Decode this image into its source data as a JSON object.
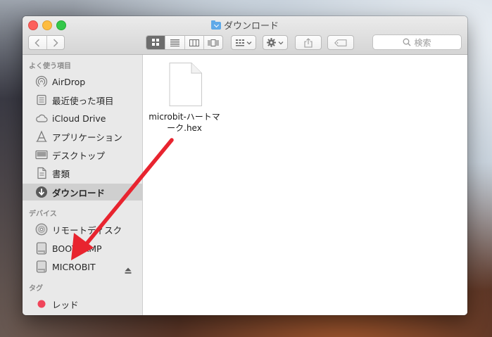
{
  "window": {
    "title": "ダウンロード"
  },
  "toolbar": {
    "back_icon": "chevron-left-icon",
    "forward_icon": "chevron-right-icon",
    "views": [
      "icon-view",
      "list-view",
      "column-view",
      "cover-flow-view"
    ],
    "active_view": "icon-view",
    "search_placeholder": "検索"
  },
  "sidebar": {
    "favorites_header": "よく使う項目",
    "favorites": [
      {
        "label": "AirDrop",
        "icon": "airdrop-icon"
      },
      {
        "label": "最近使った項目",
        "icon": "recents-icon"
      },
      {
        "label": "iCloud Drive",
        "icon": "cloud-icon"
      },
      {
        "label": "アプリケーション",
        "icon": "applications-icon"
      },
      {
        "label": "デスクトップ",
        "icon": "desktop-icon"
      },
      {
        "label": "書類",
        "icon": "documents-icon"
      },
      {
        "label": "ダウンロード",
        "icon": "downloads-icon",
        "selected": true
      }
    ],
    "devices_header": "デバイス",
    "devices": [
      {
        "label": "リモートディスク",
        "icon": "disc-icon"
      },
      {
        "label": "BOOTCAMP",
        "icon": "drive-icon"
      },
      {
        "label": "MICROBIT",
        "icon": "drive-icon",
        "ejectable": true
      }
    ],
    "tags_header": "タグ",
    "tags": [
      {
        "label": "レッド",
        "color": "#f0455a"
      }
    ]
  },
  "content": {
    "files": [
      {
        "name": "microbit-ハートマーク.hex",
        "icon": "document-icon"
      }
    ]
  },
  "colors": {
    "annotation_arrow": "#e8242f",
    "selected_row": "#cfcfcf",
    "sidebar_bg": "#e9e9e9"
  }
}
